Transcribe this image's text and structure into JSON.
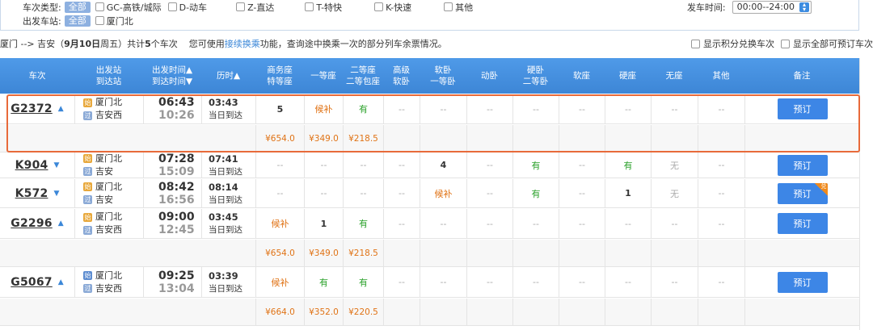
{
  "filter": {
    "type_label": "车次类型:",
    "all_label": "全部",
    "types": [
      "GC-高铁/城际",
      "D-动车",
      "Z-直达",
      "T-特快",
      "K-快速",
      "其他"
    ],
    "depart_time_label": "发车时间:",
    "depart_time_value": "00:00--24:00",
    "station_label": "出发车站:",
    "station_all_label": "全部",
    "stations": [
      "厦门北"
    ]
  },
  "summary": {
    "route": "厦门 --> 吉安（",
    "date": "9月10日",
    "weekday": " 周五）共计",
    "count": "5",
    "count_suffix": "个车次",
    "hint_prefix": "您可使用",
    "hint_link": "接续换乘",
    "hint_suffix": "功能，查询途中换乘一次的部分列车余票情况。",
    "opt_points": "显示积分兑换车次",
    "opt_all": "显示全部可预订车次"
  },
  "headers": {
    "train": "车次",
    "station_1": "出发站",
    "station_2": "到达站",
    "time_1": "出发时间▲",
    "time_2": "到达时间▼",
    "duration": "历时▲",
    "business_1": "商务座",
    "business_2": "特等座",
    "first": "一等座",
    "second_1": "二等座",
    "second_2": "二等包座",
    "adv_sleeper_1": "高级",
    "adv_sleeper_2": "软卧",
    "soft_sleeper_1": "软卧",
    "soft_sleeper_2": "一等卧",
    "moving_sleeper": "动卧",
    "hard_sleeper_1": "硬卧",
    "hard_sleeper_2": "二等卧",
    "soft_seat": "软座",
    "hard_seat": "硬座",
    "no_seat": "无座",
    "other": "其他",
    "remark": "备注"
  },
  "icons": {
    "start": "始",
    "pass": "过"
  },
  "book_label": "预订",
  "trains": [
    {
      "no": "G2372",
      "arrow": "▲",
      "from": "厦门北",
      "to": "吉安西",
      "dep": "06:43",
      "arr": "10:26",
      "dur": "03:43",
      "arrive_day": "当日到达",
      "seats": [
        "5",
        "候补",
        "有",
        "--",
        "--",
        "--",
        "--",
        "--",
        "--",
        "--",
        "--"
      ],
      "prices": [
        "¥654.0",
        "¥349.0",
        "¥218.5"
      ]
    },
    {
      "no": "K904",
      "arrow": "▼",
      "from": "厦门北",
      "to": "吉安",
      "dep": "07:28",
      "arr": "15:09",
      "dur": "07:41",
      "arrive_day": "当日到达",
      "seats": [
        "--",
        "--",
        "--",
        "--",
        "4",
        "--",
        "有",
        "--",
        "有",
        "无",
        "--"
      ]
    },
    {
      "no": "K572",
      "arrow": "▼",
      "from": "厦门北",
      "to": "吉安",
      "dep": "08:42",
      "arr": "16:56",
      "dur": "08:14",
      "arrive_day": "当日到达",
      "seats": [
        "--",
        "--",
        "--",
        "--",
        "候补",
        "--",
        "有",
        "--",
        "1",
        "无",
        "--"
      ],
      "badge": "兑"
    },
    {
      "no": "G2296",
      "arrow": "▲",
      "from": "厦门北",
      "to": "吉安西",
      "dep": "09:00",
      "arr": "12:45",
      "dur": "03:45",
      "arrive_day": "当日到达",
      "seats": [
        "候补",
        "1",
        "有",
        "--",
        "--",
        "--",
        "--",
        "--",
        "--",
        "--",
        "--"
      ],
      "prices": [
        "¥654.0",
        "¥349.0",
        "¥218.5"
      ]
    },
    {
      "no": "G5067",
      "arrow": "▲",
      "from": "厦门北",
      "to": "吉安西",
      "dep": "09:25",
      "arr": "13:04",
      "dur": "03:39",
      "arrive_day": "当日到达",
      "seats": [
        "候补",
        "有",
        "有",
        "--",
        "--",
        "--",
        "--",
        "--",
        "--",
        "--",
        "--"
      ],
      "prices": [
        "¥664.0",
        "¥352.0",
        "¥220.5"
      ]
    }
  ],
  "colors": {
    "header": "#3d86d6",
    "book": "#3d86e6",
    "green": "#2aa12a",
    "orange": "#e07316",
    "highlight": "#e86a3a"
  }
}
